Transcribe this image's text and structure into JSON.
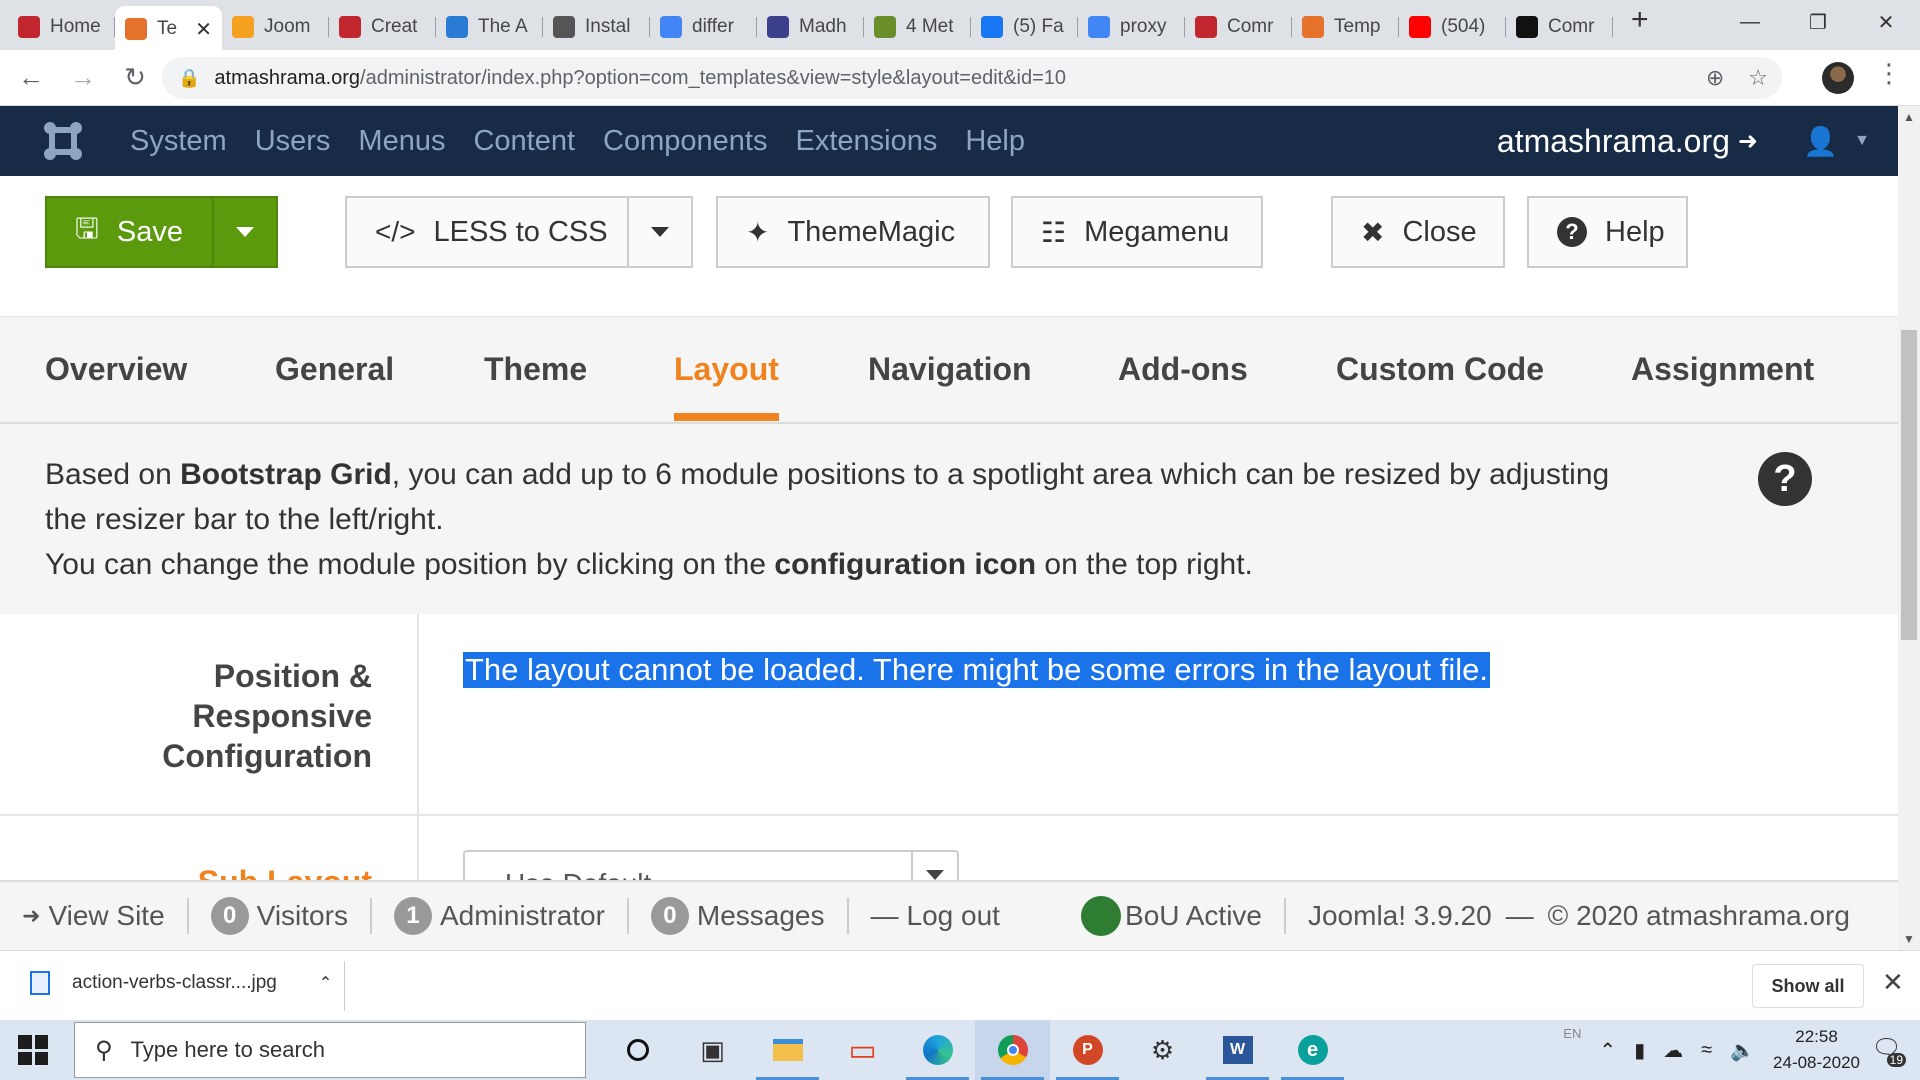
{
  "browser": {
    "tabs": [
      {
        "label": "Home",
        "icon": "joomla-icon",
        "color": "#c2262e"
      },
      {
        "label": "Te",
        "icon": "joomla-icon",
        "color": "#e5722a",
        "active": true
      },
      {
        "label": "Joom",
        "icon": "g-icon",
        "color": "#f4a020"
      },
      {
        "label": "Creat",
        "icon": "joomla-icon",
        "color": "#c2262e"
      },
      {
        "label": "The A",
        "icon": "shield-icon",
        "color": "#2a7bd3"
      },
      {
        "label": "Instal",
        "icon": "globe-icon",
        "color": "#555555"
      },
      {
        "label": "differ",
        "icon": "google-icon",
        "color": "#4285f4"
      },
      {
        "label": "Madh",
        "icon": "calendar-icon",
        "color": "#3b3f8c"
      },
      {
        "label": "4 Met",
        "icon": "pencil-icon",
        "color": "#6a8f2a"
      },
      {
        "label": "(5) Fa",
        "icon": "facebook-icon",
        "color": "#1877f2"
      },
      {
        "label": "proxy",
        "icon": "google-icon",
        "color": "#4285f4"
      },
      {
        "label": "Comr",
        "icon": "joomla-icon",
        "color": "#c2262e"
      },
      {
        "label": "Temp",
        "icon": "joomla-icon",
        "color": "#e5722a"
      },
      {
        "label": "(504)",
        "icon": "youtube-icon",
        "color": "#ff0000"
      },
      {
        "label": "Comr",
        "icon": "mountain-icon",
        "color": "#111111"
      }
    ],
    "new_tab": "+",
    "url_host": "atmashrama.org",
    "url_path": "/administrator/index.php?option=com_templates&view=style&layout=edit&id=10"
  },
  "joomla": {
    "menu": [
      "System",
      "Users",
      "Menus",
      "Content",
      "Components",
      "Extensions",
      "Help"
    ],
    "site_name": "atmashrama.org",
    "toolbar": {
      "save": "Save",
      "less_to_css": "LESS to CSS",
      "theme_magic": "ThemeMagic",
      "megamenu": "Megamenu",
      "close": "Close",
      "help": "Help"
    },
    "tabs": [
      "Overview",
      "General",
      "Theme",
      "Layout",
      "Navigation",
      "Add-ons",
      "Custom Code",
      "Assignment"
    ],
    "active_tab": "Layout",
    "info": {
      "l1a": "Based on ",
      "l1b": "Bootstrap Grid",
      "l1c": ", you can add up to 6 module positions to a spotlight area which can be resized by adjusting",
      "l2": "the resizer bar to the left/right.",
      "l3a": "You can change the module position by clicking on the ",
      "l3b": "configuration icon",
      "l3c": " on the top right."
    },
    "position_label_1": "Position &",
    "position_label_2": "Responsive",
    "position_label_3": "Configuration",
    "error_message": "The layout cannot be loaded. There might be some errors in the layout file.",
    "sub_layout_label": "Sub Layout",
    "sub_layout_value": "Use Default",
    "status": {
      "view_site": "View Site",
      "visitors_count": "0",
      "visitors": "Visitors",
      "admin_count": "1",
      "admin": "Administrator",
      "messages_count": "0",
      "messages": "Messages",
      "logout": "Log out",
      "bou": "BoU Active",
      "version": "Joomla! 3.9.20",
      "dash": "—",
      "copyright": "© 2020 atmashrama.org"
    }
  },
  "downloads": {
    "file": "action-verbs-classr....jpg",
    "show_all": "Show all"
  },
  "taskbar": {
    "search_placeholder": "Type here to search",
    "lang": "EN",
    "time": "22:58",
    "date": "24-08-2020",
    "notifications": "19"
  },
  "colors": {
    "header_bg": "#172b47",
    "save_green": "#5b9a0c",
    "accent_orange": "#f0831e",
    "selection_blue": "#1a73e8"
  }
}
